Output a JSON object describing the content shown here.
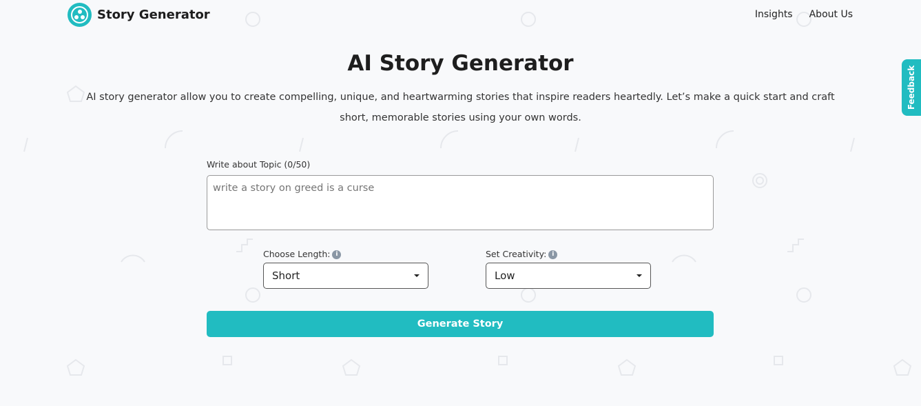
{
  "header": {
    "brand": "Story Generator",
    "nav": [
      "Insights",
      "About Us"
    ]
  },
  "main": {
    "title": "AI Story Generator",
    "description": "AI story generator allow you to create compelling, unique, and heartwarming stories that inspire readers heartedly. Let’s make a quick start and craft short, memorable stories using your own words.",
    "topic_label": "Write about Topic (0/50)",
    "topic_placeholder": "write a story on greed is a curse",
    "length_label": "Choose Length:",
    "length_value": "Short",
    "creativity_label": "Set Creativity:",
    "creativity_value": "Low",
    "generate_label": "Generate Story"
  },
  "feedback_label": "Feedback",
  "colors": {
    "accent": "#21bcc1",
    "background": "#f8f9fb"
  },
  "icons": {
    "logo": "three-dots-circle-icon",
    "info": "info-icon",
    "caret": "caret-down-icon"
  }
}
